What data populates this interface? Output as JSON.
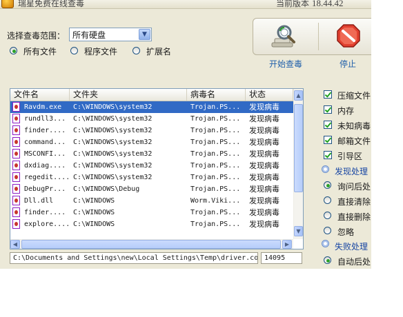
{
  "window": {
    "title": "瑞星免费在线查毒",
    "version_label": "当前版本",
    "version_value": "18.44.42"
  },
  "scope": {
    "label": "选择查毒范围：",
    "selected": "所有硬盘",
    "file_types": [
      {
        "label": "所有文件",
        "checked": true
      },
      {
        "label": "程序文件",
        "checked": false
      },
      {
        "label": "扩展名",
        "checked": false
      }
    ]
  },
  "buttons": {
    "start_scan": "开始查毒",
    "stop": "停止"
  },
  "table": {
    "columns": [
      "文件名",
      "文件夹",
      "病毒名",
      "状态"
    ],
    "rows": [
      {
        "file": "Ravdm.exe",
        "folder": "C:\\WINDOWS\\system32",
        "virus": "Trojan.PS...",
        "status": "发现病毒",
        "selected": true
      },
      {
        "file": "rundll3...",
        "folder": "C:\\WINDOWS\\system32",
        "virus": "Trojan.PS...",
        "status": "发现病毒"
      },
      {
        "file": "finder....",
        "folder": "C:\\WINDOWS\\system32",
        "virus": "Trojan.PS...",
        "status": "发现病毒"
      },
      {
        "file": "command...",
        "folder": "C:\\WINDOWS\\system32",
        "virus": "Trojan.PS...",
        "status": "发现病毒"
      },
      {
        "file": "MSCONFI...",
        "folder": "C:\\WINDOWS\\system32",
        "virus": "Trojan.PS...",
        "status": "发现病毒"
      },
      {
        "file": "dxdiag....",
        "folder": "C:\\WINDOWS\\system32",
        "virus": "Trojan.PS...",
        "status": "发现病毒"
      },
      {
        "file": "regedit....",
        "folder": "C:\\WINDOWS\\system32",
        "virus": "Trojan.PS...",
        "status": "发现病毒"
      },
      {
        "file": "DebugPr...",
        "folder": "C:\\WINDOWS\\Debug",
        "virus": "Trojan.PS...",
        "status": "发现病毒"
      },
      {
        "file": "Dll.dll",
        "folder": "C:\\WINDOWS",
        "virus": "Worm.Viki...",
        "status": "发现病毒"
      },
      {
        "file": "finder....",
        "folder": "C:\\WINDOWS",
        "virus": "Trojan.PS...",
        "status": "发现病毒"
      },
      {
        "file": "explore....",
        "folder": "C:\\WINDOWS",
        "virus": "Trojan.PS...",
        "status": "发现病毒"
      }
    ]
  },
  "status_bar": {
    "path": "C:\\Documents and Settings\\new\\Local Settings\\Temp\\driver.co",
    "count": "14095"
  },
  "scan_targets": [
    {
      "label": "压缩文件",
      "checked": true
    },
    {
      "label": "内存",
      "checked": true
    },
    {
      "label": "未知病毒",
      "checked": true
    },
    {
      "label": "邮箱文件",
      "checked": true
    },
    {
      "label": "引导区",
      "checked": true
    }
  ],
  "found_action": {
    "group_label": "发现处理",
    "options": [
      {
        "label": "询问后处",
        "checked": true
      },
      {
        "label": "直接清除",
        "checked": false
      },
      {
        "label": "直接删除",
        "checked": false
      },
      {
        "label": "忽略",
        "checked": false
      }
    ]
  },
  "fail_action": {
    "group_label": "失败处理",
    "options": [
      {
        "label": "自动后处",
        "checked": true
      }
    ]
  },
  "icons": [
    "app-shield-icon",
    "magnifier-scan-icon",
    "stop-sign-icon",
    "infected-file-icon"
  ]
}
